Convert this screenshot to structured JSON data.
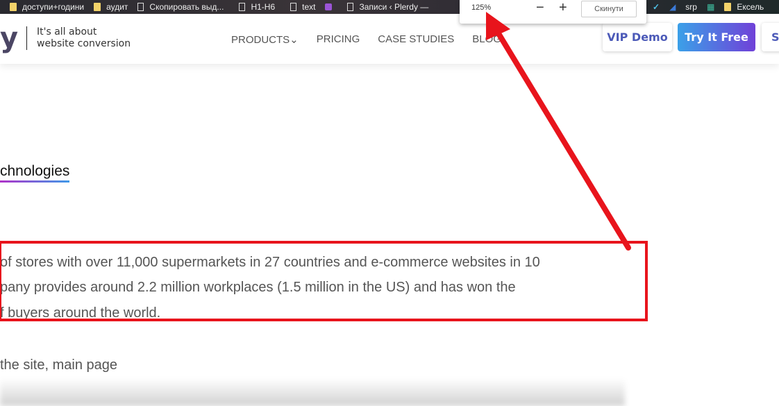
{
  "bookmarks": [
    {
      "icon": "folder-icon",
      "label": "доступи+години"
    },
    {
      "icon": "folder-icon",
      "label": "аудит"
    },
    {
      "icon": "page-icon",
      "label": "Скопировать выд..."
    },
    {
      "icon": "page-icon",
      "label": "H1-H6"
    },
    {
      "icon": "page-icon",
      "label": "text"
    },
    {
      "icon": "plugin-icon",
      "label": ""
    },
    {
      "icon": "page-icon",
      "label": "Записи ‹ Plerdy —"
    }
  ],
  "tray": {
    "srp": "srp",
    "excel": "Ексель"
  },
  "zoom_popup": {
    "value": "125%",
    "minus": "−",
    "plus": "+",
    "reset_label": "Скинути"
  },
  "header": {
    "logo": "y",
    "tagline_1": "It's all about",
    "tagline_2": "website conversion",
    "nav": [
      "PRODUCTS⌄",
      "PRICING",
      "CASE STUDIES",
      "BLOG"
    ],
    "vip_demo": "VIP Demo",
    "try_free": "Try It Free",
    "third_button": "S"
  },
  "content": {
    "heading": "chnologies",
    "lines": [
      "of stores with over 11,000 supermarkets in 27 countries and e-commerce websites in 10",
      "pany provides around 2.2 million workplaces (1.5 million in the US) and has won the",
      "f buyers around the world."
    ],
    "caption": " the site, main page"
  },
  "annotation_color": "#e8141c"
}
